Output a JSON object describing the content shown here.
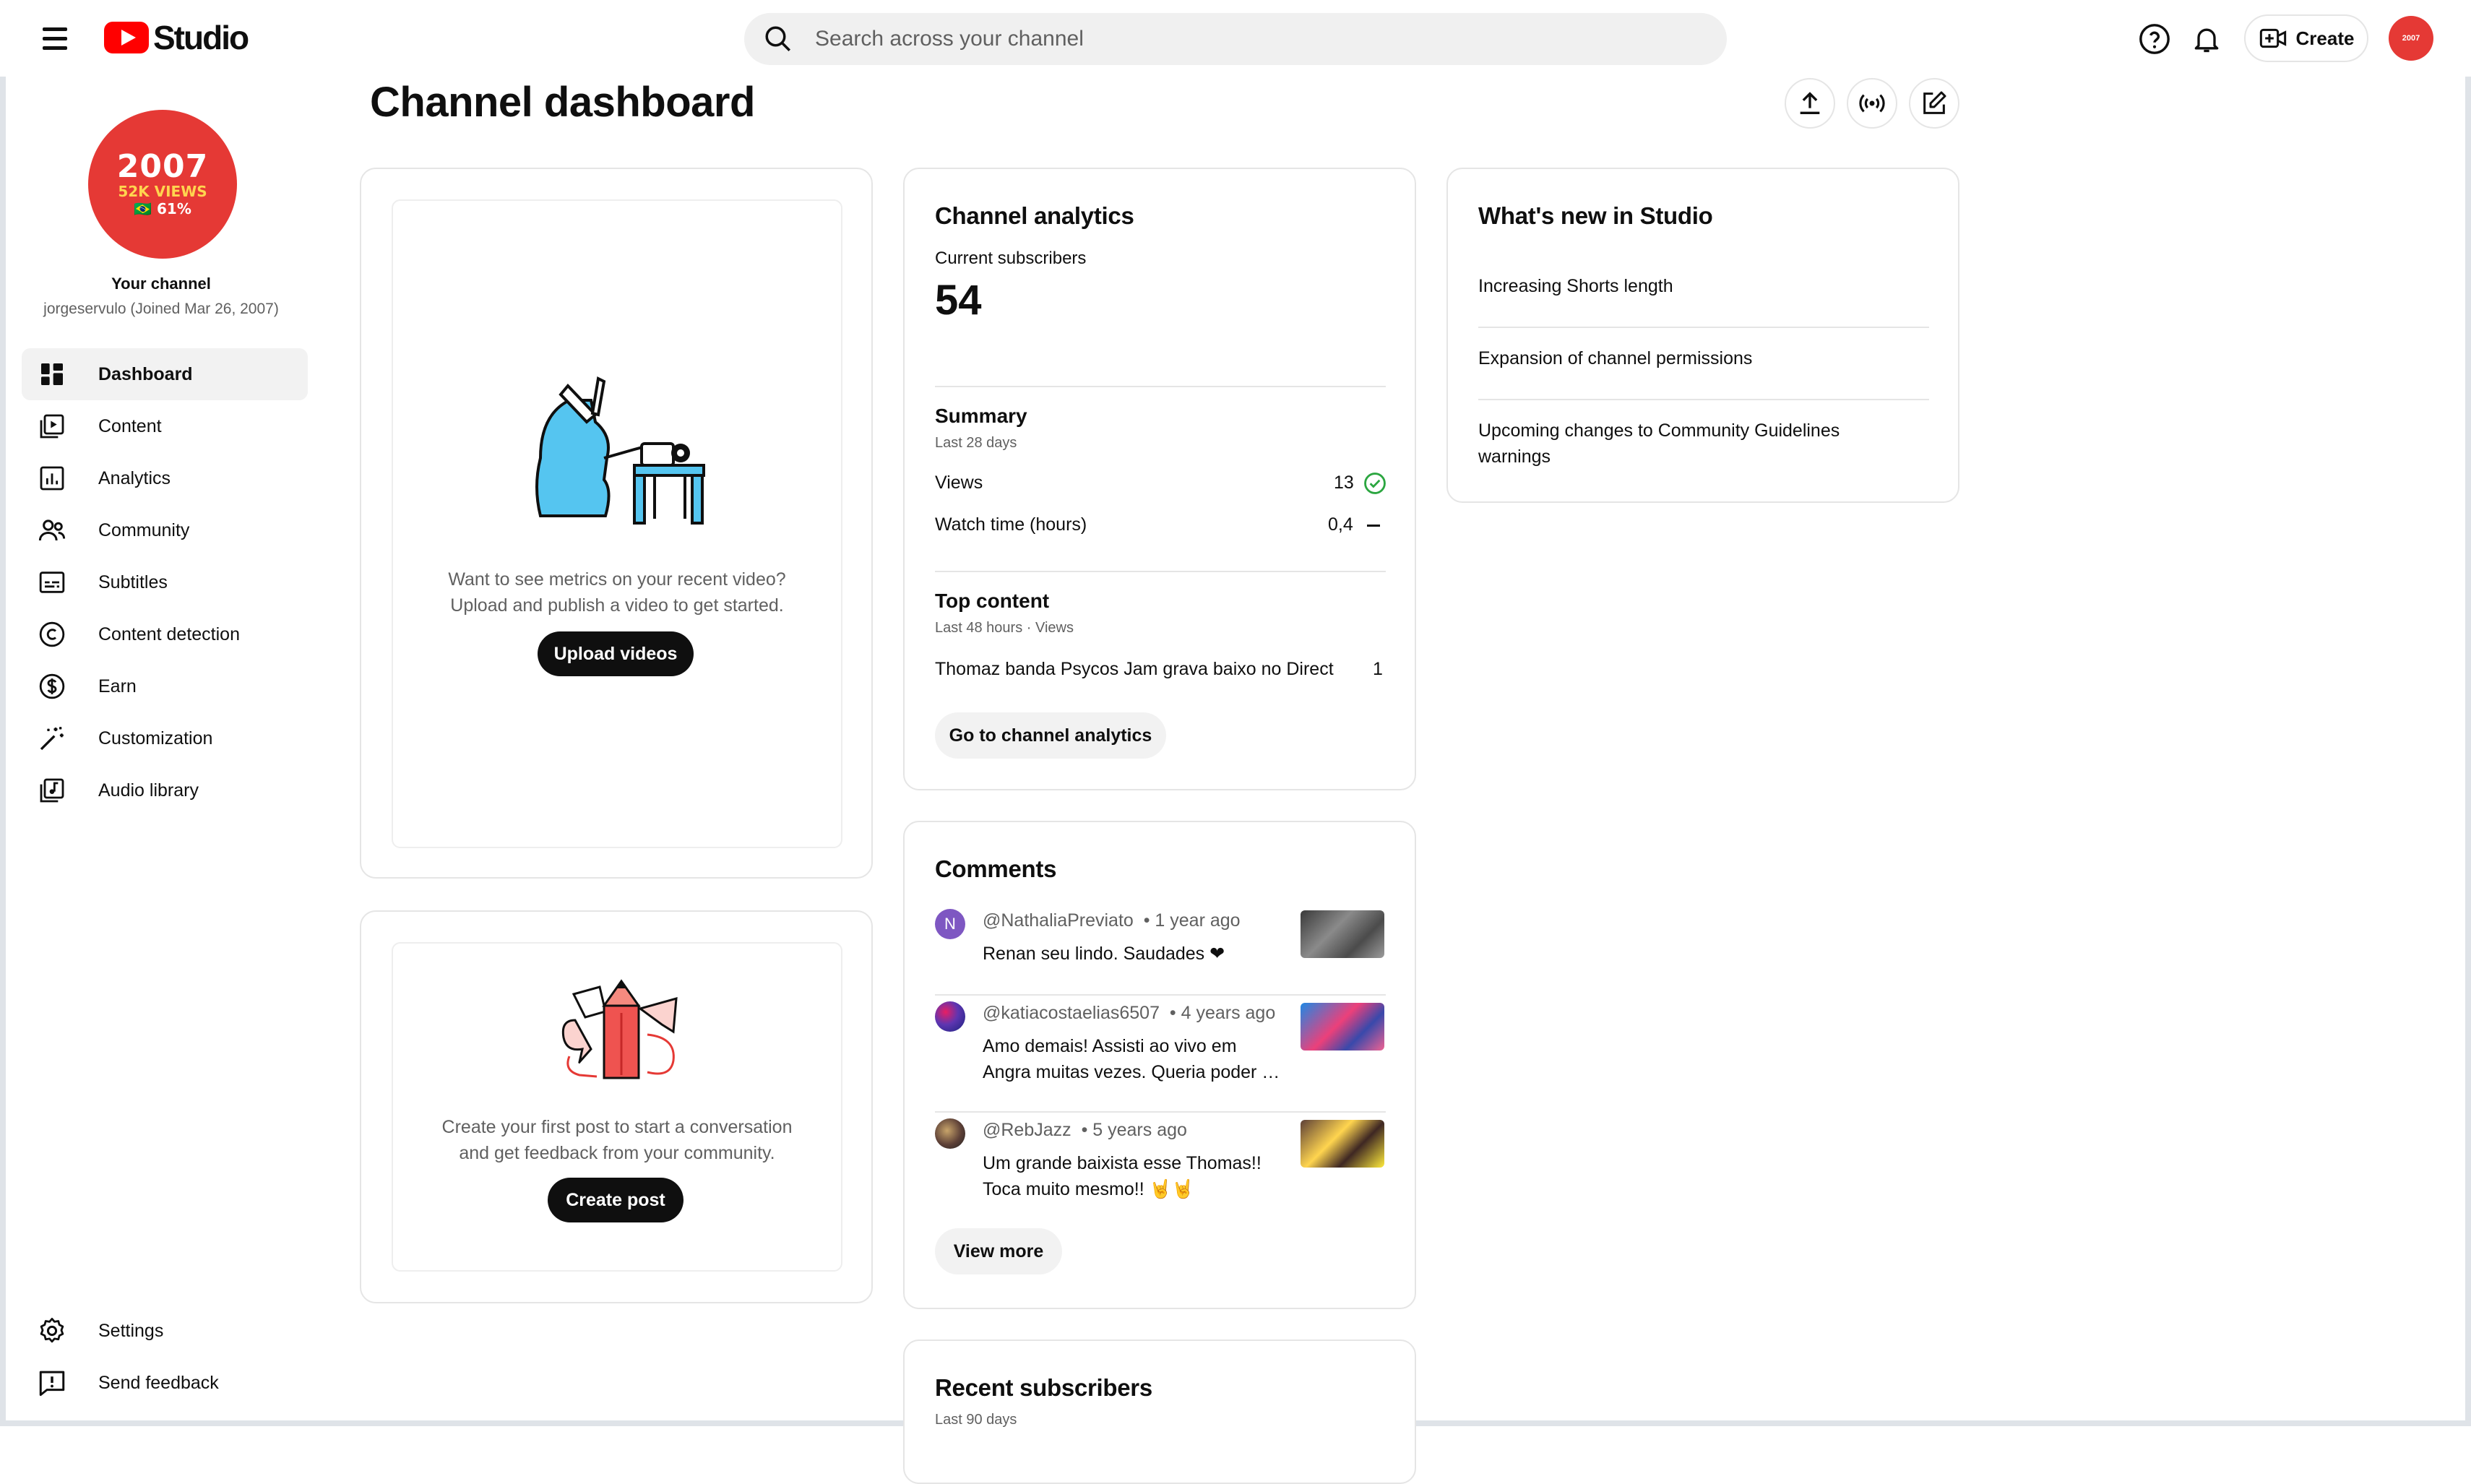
{
  "header": {
    "logo_text": "Studio",
    "search_placeholder": "Search across your channel",
    "create_label": "Create",
    "account_avatar_text": "2007"
  },
  "sidebar": {
    "avatar_line1": "2007",
    "avatar_line2": "52K VIEWS",
    "avatar_line3": "🇧🇷 61%",
    "channel_label": "Your channel",
    "channel_handle": "jorgeservulo (Joined Mar 26, 2007)",
    "items": [
      {
        "label": "Dashboard",
        "icon": "dashboard-icon"
      },
      {
        "label": "Content",
        "icon": "content-icon"
      },
      {
        "label": "Analytics",
        "icon": "analytics-icon"
      },
      {
        "label": "Community",
        "icon": "community-icon"
      },
      {
        "label": "Subtitles",
        "icon": "subtitles-icon"
      },
      {
        "label": "Content detection",
        "icon": "copyright-icon"
      },
      {
        "label": "Earn",
        "icon": "dollar-icon"
      },
      {
        "label": "Customization",
        "icon": "magic-wand-icon"
      },
      {
        "label": "Audio library",
        "icon": "audio-library-icon"
      }
    ],
    "bottom_items": [
      {
        "label": "Settings",
        "icon": "gear-icon"
      },
      {
        "label": "Send feedback",
        "icon": "feedback-icon"
      }
    ]
  },
  "main": {
    "title": "Channel dashboard",
    "upload_card": {
      "text_line1": "Want to see metrics on your recent video?",
      "text_line2": "Upload and publish a video to get started.",
      "button": "Upload videos"
    },
    "post_card": {
      "text_line1": "Create your first post to start a conversation",
      "text_line2": "and get feedback from your community.",
      "button": "Create post"
    },
    "analytics": {
      "title": "Channel analytics",
      "subs_label": "Current subscribers",
      "subs_value": "54",
      "summary_title": "Summary",
      "summary_period": "Last 28 days",
      "rows": [
        {
          "label": "Views",
          "value": "13",
          "status": "check-icon"
        },
        {
          "label": "Watch time (hours)",
          "value": "0,4",
          "status": "dash-icon"
        }
      ],
      "top_title": "Top content",
      "top_period": "Last 48 hours · Views",
      "top_item": "Thomaz banda Psycos Jam grava baixo no Direct S…",
      "top_item_value": "1",
      "button": "Go to channel analytics"
    },
    "comments": {
      "title": "Comments",
      "items": [
        {
          "handle": "@NathaliaPreviato",
          "age": "• 1 year ago",
          "text": "Renan seu lindo. Saudades ❤",
          "avatar_letter": "N"
        },
        {
          "handle": "@katiacostaelias6507",
          "age": "• 4 years ago",
          "text_line1": "Amo demais! Assisti ao vivo em",
          "text_line2": "Angra muitas vezes. Queria poder …"
        },
        {
          "handle": "@RebJazz",
          "age": "• 5 years ago",
          "text_line1": "Um grande baixista esse Thomas!!",
          "text_line2": "Toca muito mesmo!! 🤘🤘"
        }
      ],
      "button": "View more"
    },
    "recent_subscribers": {
      "title": "Recent subscribers",
      "period": "Last 90 days"
    },
    "whats_new": {
      "title": "What's new in Studio",
      "items": [
        "Increasing Shorts length",
        "Expansion of channel permissions",
        "Upcoming changes to Community Guidelines",
        "warnings"
      ]
    }
  },
  "colors": {
    "brand_red": "#ff0000",
    "avatar_red": "#e53935",
    "check_green": "#2ba640",
    "illustration_blue": "#55c5f0"
  }
}
